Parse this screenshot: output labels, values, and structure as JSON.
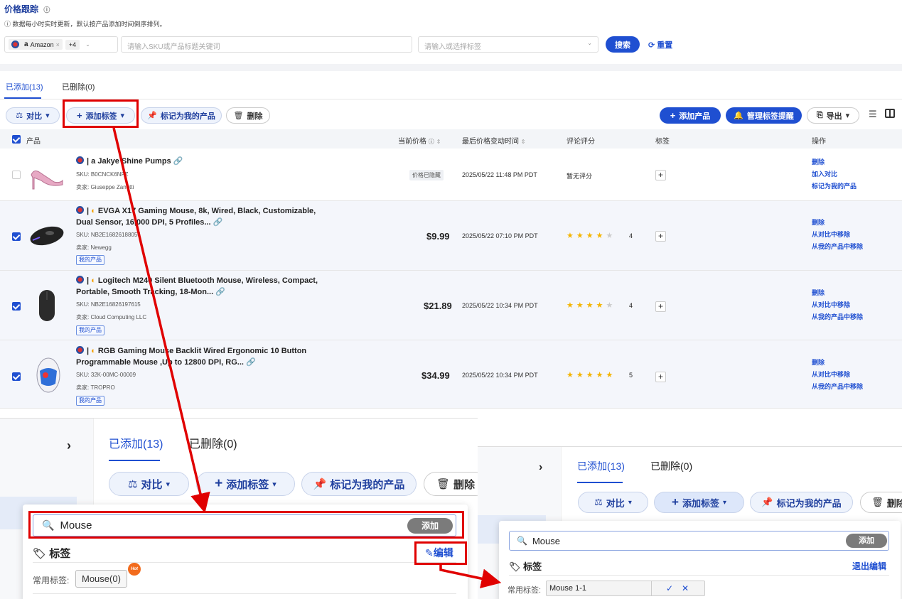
{
  "header": {
    "title": "价格跟踪",
    "notice": "数据每小时实时更新，默认按产品添加时间倒序排列。"
  },
  "filters": {
    "marketplace": "Amazon",
    "more_count": "+4",
    "search_placeholder": "请输入SKU或产品标题关键词",
    "tag_placeholder": "请输入或选择标签",
    "search_btn": "搜索",
    "reset_btn": "重置"
  },
  "tabs": {
    "added": "已添加(13)",
    "deleted": "已删除(0)"
  },
  "toolbar": {
    "compare": "对比",
    "add_tag": "添加标签",
    "mark_mine": "标记为我的产品",
    "delete": "删除",
    "add_product": "添加产品",
    "manage_alerts": "管理标签提醒",
    "export": "导出"
  },
  "table": {
    "headers": {
      "product": "产品",
      "current_price": "当前价格",
      "last_change": "最后价格变动时间",
      "rating": "评论评分",
      "tags": "标签",
      "actions": "操作"
    },
    "rows": [
      {
        "title_l1": "Jakye Shine Pumps",
        "title_l2": "",
        "sku": "SKU: B0CNCK6NFZ",
        "seller": "卖家: Giuseppe Zanotti",
        "my_tag": "",
        "price": "价格已隐藏",
        "date": "2025/05/22 11:48 PM PDT",
        "rating": "暂无评分",
        "actions": [
          "删除",
          "加入对比",
          "标记为我的产品"
        ]
      },
      {
        "title_l1": "EVGA X17 Gaming Mouse, 8k, Wired, Black, Customizable,",
        "title_l2": "Dual Sensor, 16,000 DPI, 5 Profiles...",
        "sku": "SKU: NB2E16826188056",
        "seller": "卖家: Newegg",
        "my_tag": "我的产品",
        "price": "$9.99",
        "date": "2025/05/22 07:10 PM PDT",
        "rating_value": 4,
        "rating": "4",
        "actions": [
          "删除",
          "从对比中移除",
          "从我的产品中移除"
        ]
      },
      {
        "title_l1": "Logitech M240 Silent Bluetooth Mouse, Wireless, Compact,",
        "title_l2": "Portable, Smooth Tracking, 18-Mon...",
        "sku": "SKU: NB2E16826197615",
        "seller": "卖家: Cloud Computing LLC",
        "my_tag": "我的产品",
        "price": "$21.89",
        "date": "2025/05/22 10:34 PM PDT",
        "rating_value": 4,
        "rating": "4",
        "actions": [
          "删除",
          "从对比中移除",
          "从我的产品中移除"
        ]
      },
      {
        "title_l1": "RGB Gaming Mouse Backlit Wired Ergonomic 10 Button",
        "title_l2": "Programmable Mouse ,Up to 12800 DPI, RG...",
        "sku": "SKU: 32K-00MC-00009",
        "seller": "卖家: TROPRO",
        "my_tag": "我的产品",
        "price": "$34.99",
        "date": "2025/05/22 10:34 PM PDT",
        "rating_value": 5,
        "rating": "5",
        "actions": [
          "删除",
          "从对比中移除",
          "从我的产品中移除"
        ]
      }
    ]
  },
  "zoom1": {
    "tab_added": "已添加(13)",
    "tab_deleted": "已删除(0)",
    "compare": "对比",
    "add_tag": "添加标签",
    "mark_mine": "标记为我的产品",
    "delete": "删除",
    "search_value": "Mouse",
    "add_btn": "添加",
    "section": "标签",
    "edit": "编辑",
    "common_label": "常用标签:",
    "chip": "Mouse(0)",
    "hot": "Hot"
  },
  "zoom2": {
    "tab_added": "已添加(13)",
    "tab_deleted": "已删除(0)",
    "compare": "对比",
    "add_tag": "添加标签",
    "mark_mine": "标记为我的产品",
    "delete": "删除",
    "search_value": "Mouse",
    "add_btn": "添加",
    "section": "标签",
    "exit_edit": "退出编辑",
    "common_label": "常用标签:",
    "edit_value": "Mouse 1-1"
  },
  "colors": {
    "accent": "#1f4fd1",
    "annotation": "#e00000",
    "star": "#f4b400"
  }
}
